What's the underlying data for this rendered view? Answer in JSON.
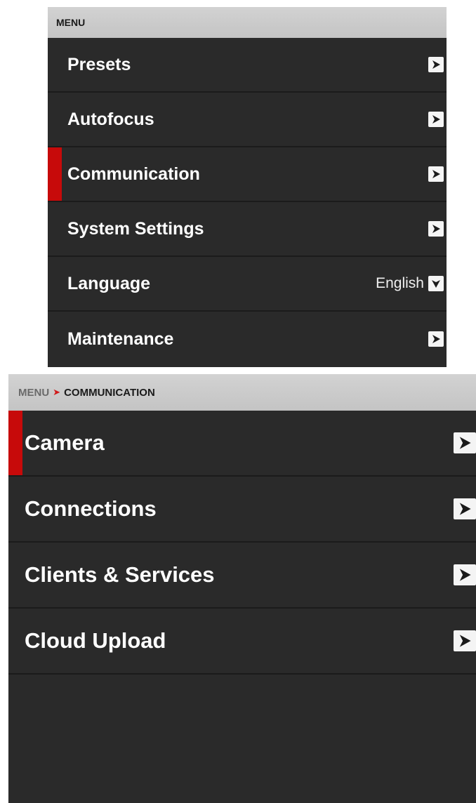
{
  "menu_panel": {
    "header": "MENU",
    "items": [
      {
        "label": "Presets",
        "control": "arrow"
      },
      {
        "label": "Autofocus",
        "control": "arrow"
      },
      {
        "label": "Communication",
        "control": "arrow",
        "selected": true
      },
      {
        "label": "System Settings",
        "control": "arrow"
      },
      {
        "label": "Language",
        "control": "dropdown",
        "value": "English"
      },
      {
        "label": "Maintenance",
        "control": "arrow"
      }
    ]
  },
  "communication_panel": {
    "breadcrumb": {
      "root": "MENU",
      "separator": "➤",
      "current": "COMMUNICATION"
    },
    "items": [
      {
        "label": "Camera",
        "control": "arrow",
        "selected": true
      },
      {
        "label": "Connections",
        "control": "arrow"
      },
      {
        "label": "Clients & Services",
        "control": "arrow"
      },
      {
        "label": "Cloud Upload",
        "control": "arrow"
      }
    ]
  },
  "colors": {
    "panel_bg": "#2a2a2a",
    "header_bg": "#c8c8c8",
    "accent_red": "#c70a0a",
    "text": "#ffffff"
  },
  "icons": {
    "arrow": "chevron-right-icon",
    "dropdown": "chevron-down-icon"
  }
}
